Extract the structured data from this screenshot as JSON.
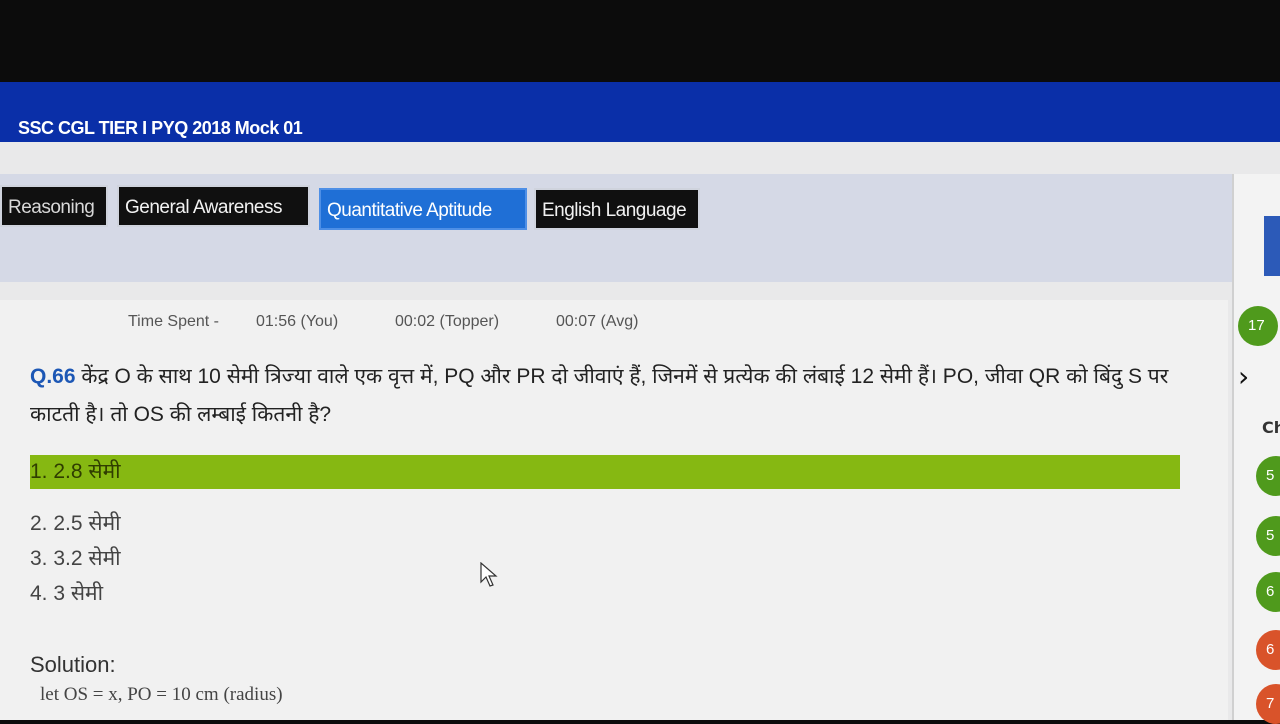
{
  "header": {
    "title": "SSC CGL TIER I PYQ 2018 Mock 01"
  },
  "tabs": [
    {
      "label": "Reasoning",
      "active": false
    },
    {
      "label": "General Awareness",
      "active": false
    },
    {
      "label": "Quantitative Aptitude",
      "active": true
    },
    {
      "label": "English Language",
      "active": false
    }
  ],
  "time": {
    "label": "Time Spent -",
    "you": "01:56 (You)",
    "topper": "00:02 (Topper)",
    "avg": "00:07 (Avg)"
  },
  "question": {
    "number": "Q.66",
    "text": "केंद्र O के साथ 10 सेमी त्रिज्या वाले एक वृत्त में, PQ और PR दो जीवाएं हैं, जिनमें से प्रत्येक की लंबाई 12 सेमी हैं। PO, जीवा QR को बिंदु S पर काटती है। तो OS की लम्बाई कितनी है?"
  },
  "options": [
    {
      "label": "1. 2.8 सेमी",
      "correct": true
    },
    {
      "label": "2. 2.5 सेमी",
      "correct": false
    },
    {
      "label": "3. 3.2 सेमी",
      "correct": false
    },
    {
      "label": "4. 3 सेमी",
      "correct": false
    }
  ],
  "solution": {
    "heading": "Solution:",
    "line1": "let OS = x, PO = 10 cm (radius)"
  },
  "sidebar": {
    "count_badge": "17",
    "ch_label": "Ch",
    "numbers": [
      "5",
      "5",
      "6",
      "6",
      "7"
    ]
  },
  "colors": {
    "header_blue": "#0a2fa8",
    "active_tab": "#1f6fd6",
    "correct_option": "#86b812",
    "badge_green": "#4f9a1c",
    "badge_orange": "#d9532a"
  }
}
